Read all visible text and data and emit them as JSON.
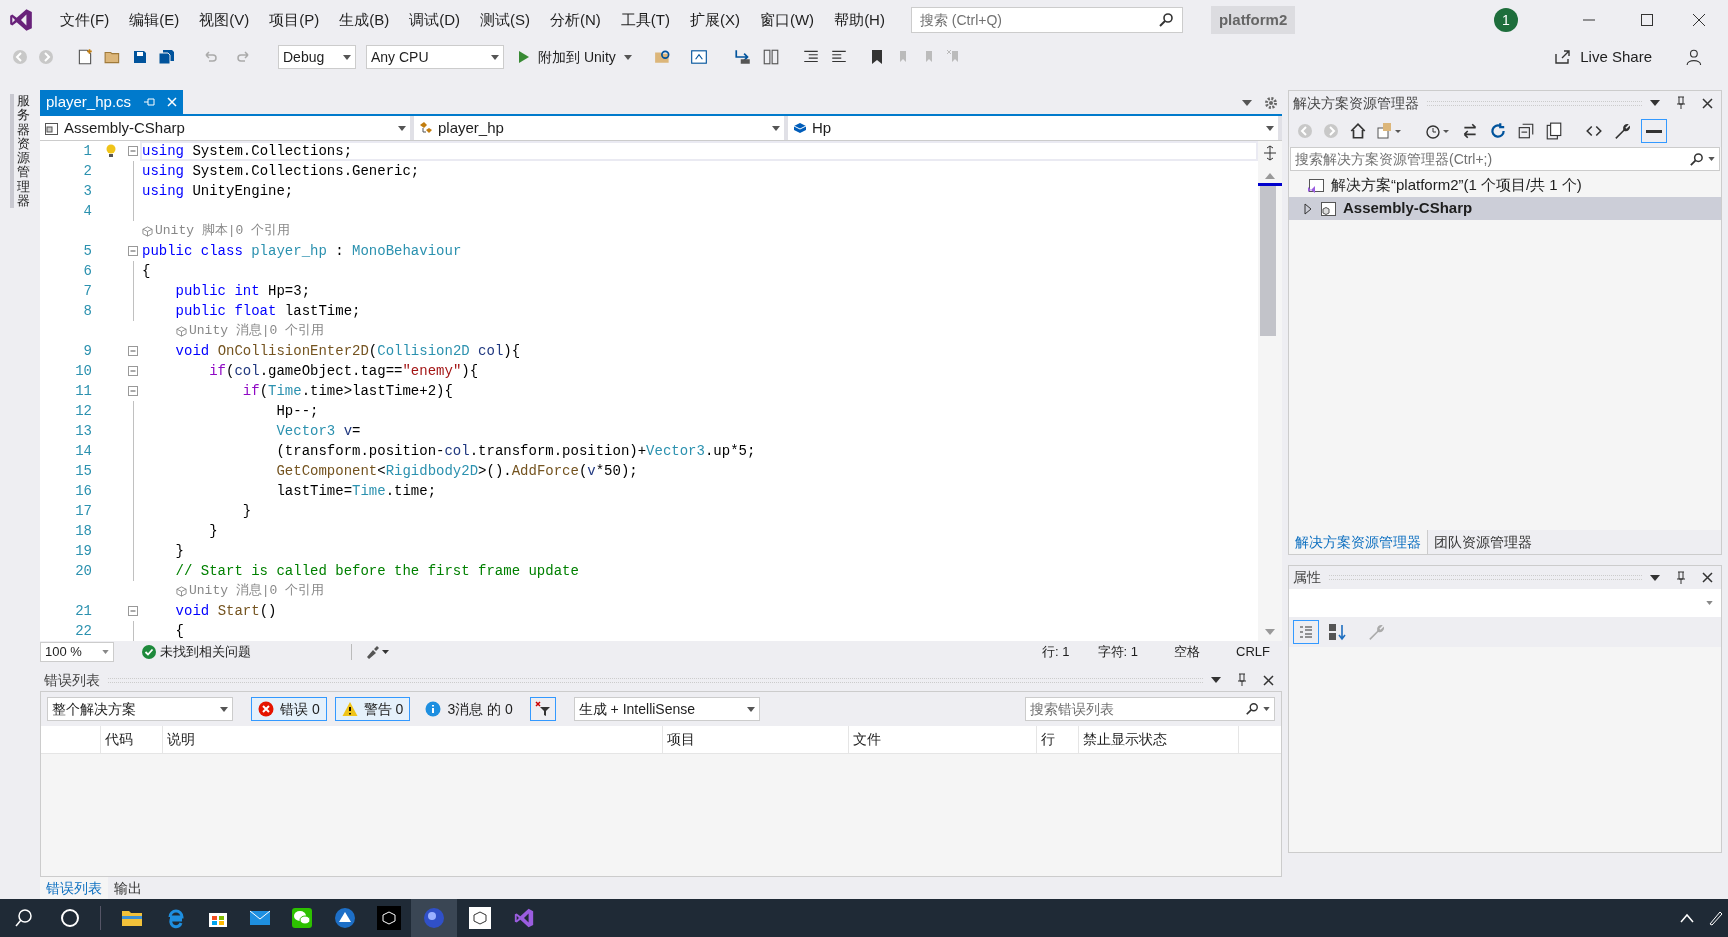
{
  "menu": [
    "文件(F)",
    "编辑(E)",
    "视图(V)",
    "项目(P)",
    "生成(B)",
    "调试(D)",
    "测试(S)",
    "分析(N)",
    "工具(T)",
    "扩展(X)",
    "窗口(W)",
    "帮助(H)"
  ],
  "search": {
    "placeholder": "搜索 (Ctrl+Q)"
  },
  "solution_name": "platform2",
  "notification_count": "1",
  "toolbar": {
    "configuration": "Debug",
    "platform": "Any CPU",
    "run_button": "附加到 Unity",
    "live_share": "Live Share"
  },
  "side_tab": "服务器资源管理器",
  "editor": {
    "tabs": [
      {
        "label": "player_hp.cs",
        "selected": true
      }
    ],
    "nav": [
      "Assembly-CSharp",
      "player_hp",
      "Hp"
    ],
    "lines": [
      {
        "kind": "code",
        "number": "1",
        "fold": true,
        "tokens": [
          {
            "kind": "keyword",
            "text": "using"
          },
          {
            "kind": "plain",
            "text": " System.Collections;"
          }
        ]
      },
      {
        "kind": "code",
        "number": "2",
        "fold": false,
        "tokens": [
          {
            "kind": "keyword",
            "text": "using"
          },
          {
            "kind": "plain",
            "text": " System.Collections.Generic;"
          }
        ]
      },
      {
        "kind": "code",
        "number": "3",
        "fold": false,
        "tokens": [
          {
            "kind": "keyword",
            "text": "using"
          },
          {
            "kind": "plain",
            "text": " UnityEngine;"
          }
        ]
      },
      {
        "kind": "code",
        "number": "4",
        "fold": false
      },
      {
        "kind": "codelens",
        "text": "Unity 脚本|0 个引用"
      },
      {
        "kind": "code",
        "number": "5",
        "fold": true,
        "tokens": [
          {
            "kind": "keyword",
            "text": "public class "
          },
          {
            "kind": "type",
            "text": "player_hp"
          },
          {
            "kind": "plain",
            "text": " : "
          },
          {
            "kind": "type",
            "text": "MonoBehaviour"
          }
        ]
      },
      {
        "kind": "code",
        "number": "6",
        "fold": false,
        "tokens": [
          {
            "kind": "plain",
            "text": "{"
          }
        ]
      },
      {
        "kind": "code",
        "number": "7",
        "fold": false,
        "tokens": [
          {
            "kind": "keyword",
            "text": "    public int"
          },
          {
            "kind": "plain",
            "text": " Hp=3;"
          }
        ]
      },
      {
        "kind": "code",
        "number": "8",
        "fold": false,
        "tokens": [
          {
            "kind": "keyword",
            "text": "    public float"
          },
          {
            "kind": "plain",
            "text": " lastTime;"
          }
        ]
      },
      {
        "kind": "codelens",
        "text": "Unity 消息|0 个引用"
      },
      {
        "kind": "code",
        "number": "9",
        "fold": true,
        "tokens": [
          {
            "kind": "keyword",
            "text": "    void "
          },
          {
            "kind": "method",
            "text": "OnCollisionEnter2D"
          },
          {
            "kind": "plain",
            "text": "("
          },
          {
            "kind": "type",
            "text": "Collision2D"
          },
          {
            "kind": "variable",
            "text": " col"
          },
          {
            "kind": "plain",
            "text": "){"
          }
        ]
      },
      {
        "kind": "code",
        "number": "10",
        "fold": true,
        "tokens": [
          {
            "kind": "control",
            "text": "        if"
          },
          {
            "kind": "plain",
            "text": "("
          },
          {
            "kind": "variable",
            "text": "col"
          },
          {
            "kind": "plain",
            "text": ".gameObject.tag=="
          },
          {
            "kind": "string",
            "text": "\"enemy\""
          },
          {
            "kind": "plain",
            "text": "){"
          }
        ]
      },
      {
        "kind": "code",
        "number": "11",
        "fold": true,
        "tokens": [
          {
            "kind": "control",
            "text": "            if"
          },
          {
            "kind": "plain",
            "text": "("
          },
          {
            "kind": "type",
            "text": "Time"
          },
          {
            "kind": "plain",
            "text": ".time>lastTime+2){"
          }
        ]
      },
      {
        "kind": "code",
        "number": "12",
        "fold": false,
        "tokens": [
          {
            "kind": "plain",
            "text": "                Hp--;"
          }
        ]
      },
      {
        "kind": "code",
        "number": "13",
        "fold": false,
        "tokens": [
          {
            "kind": "type",
            "text": "                Vector3"
          },
          {
            "kind": "variable",
            "text": " v"
          },
          {
            "kind": "plain",
            "text": "="
          }
        ]
      },
      {
        "kind": "code",
        "number": "14",
        "fold": false,
        "tokens": [
          {
            "kind": "plain",
            "text": "                (transform.position-"
          },
          {
            "kind": "variable",
            "text": "col"
          },
          {
            "kind": "plain",
            "text": ".transform.position)+"
          },
          {
            "kind": "type",
            "text": "Vector3"
          },
          {
            "kind": "plain",
            "text": ".up*5;"
          }
        ]
      },
      {
        "kind": "code",
        "number": "15",
        "fold": false,
        "tokens": [
          {
            "kind": "method",
            "text": "                GetComponent"
          },
          {
            "kind": "plain",
            "text": "<"
          },
          {
            "kind": "type",
            "text": "Rigidbody2D"
          },
          {
            "kind": "plain",
            "text": ">()."
          },
          {
            "kind": "method",
            "text": "AddForce"
          },
          {
            "kind": "plain",
            "text": "("
          },
          {
            "kind": "variable",
            "text": "v"
          },
          {
            "kind": "plain",
            "text": "*50);"
          }
        ]
      },
      {
        "kind": "code",
        "number": "16",
        "fold": false,
        "tokens": [
          {
            "kind": "plain",
            "text": "                lastTime="
          },
          {
            "kind": "type",
            "text": "Time"
          },
          {
            "kind": "plain",
            "text": ".time;"
          }
        ]
      },
      {
        "kind": "code",
        "number": "17",
        "fold": false,
        "tokens": [
          {
            "kind": "plain",
            "text": "            }"
          }
        ]
      },
      {
        "kind": "code",
        "number": "18",
        "fold": false,
        "tokens": [
          {
            "kind": "plain",
            "text": "        }"
          }
        ]
      },
      {
        "kind": "code",
        "number": "19",
        "fold": false,
        "tokens": [
          {
            "kind": "plain",
            "text": "    }"
          }
        ]
      },
      {
        "kind": "code",
        "number": "20",
        "fold": false,
        "tokens": [
          {
            "kind": "comment",
            "text": "    // Start is called before the first frame update"
          }
        ]
      },
      {
        "kind": "codelens",
        "text": "Unity 消息|0 个引用"
      },
      {
        "kind": "code",
        "number": "21",
        "fold": true,
        "tokens": [
          {
            "kind": "keyword",
            "text": "    void "
          },
          {
            "kind": "method",
            "text": "Start"
          },
          {
            "kind": "plain",
            "text": "()"
          }
        ]
      },
      {
        "kind": "code",
        "number": "22",
        "fold": false,
        "tokens": [
          {
            "kind": "plain",
            "text": "    {"
          }
        ]
      }
    ],
    "status": {
      "zoom": "100 %",
      "issues": "未找到相关问题",
      "line": "行: 1",
      "char": "字符: 1",
      "spacing": "空格",
      "eol": "CRLF"
    }
  },
  "error_list": {
    "title": "错误列表",
    "scope": "整个解决方案",
    "filters": [
      {
        "kind": "error",
        "label": "错误 0",
        "on": true
      },
      {
        "kind": "warning",
        "label": "警告 0",
        "on": true
      },
      {
        "kind": "info",
        "label": "3消息 的 0",
        "on": false
      }
    ],
    "source": "生成 + IntelliSense",
    "search_placeholder": "搜索错误列表",
    "columns": [
      "代码",
      "说明",
      "项目",
      "文件",
      "行",
      "禁止显示状态"
    ]
  },
  "bottom_tabs": [
    {
      "label": "错误列表",
      "selected": true
    },
    {
      "label": "输出",
      "selected": false
    }
  ],
  "solution_explorer": {
    "title": "解决方案资源管理器",
    "search_placeholder": "搜索解决方案资源管理器(Ctrl+;)",
    "tree": [
      {
        "label": "解决方案“platform2”(1 个项目/共 1 个)",
        "kind": "solution",
        "selected": false,
        "children": [
          {
            "label": "Assembly-CSharp",
            "kind": "project",
            "selected": true,
            "expanded": false
          }
        ]
      }
    ],
    "tabs": [
      {
        "label": "解决方案资源管理器",
        "selected": true
      },
      {
        "label": "团队资源管理器",
        "selected": false
      }
    ]
  },
  "properties": {
    "title": "属性"
  }
}
